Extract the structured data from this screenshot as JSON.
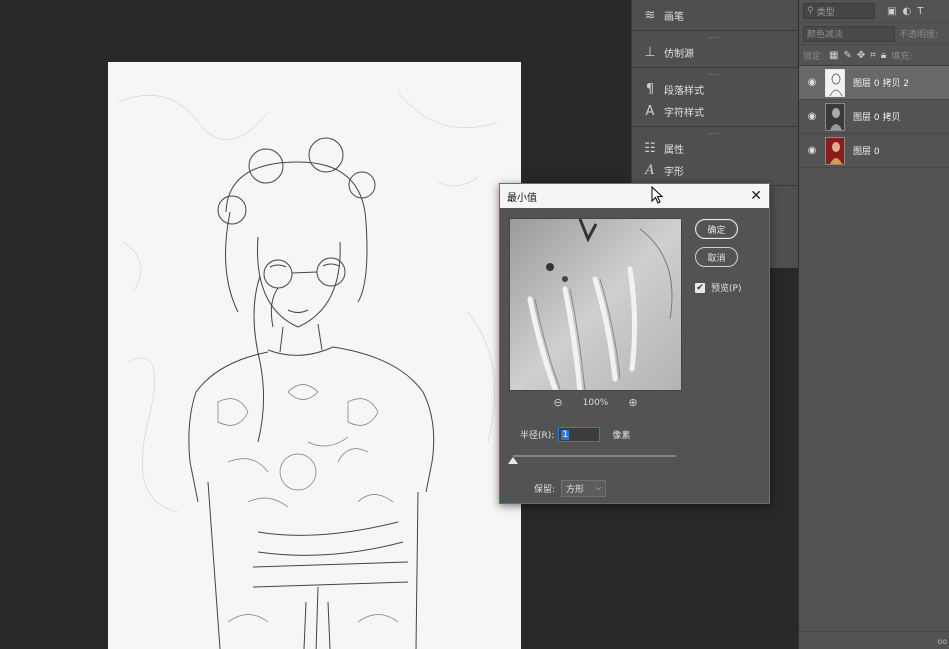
{
  "canvas": {
    "image": "pencil-sketch-portrait"
  },
  "mid_panel": {
    "groups": [
      {
        "items": [
          {
            "icon": "brush-settings-icon",
            "label": "画笔"
          }
        ]
      },
      {
        "items": [
          {
            "icon": "clone-source-icon",
            "label": "仿制源"
          }
        ]
      },
      {
        "items": [
          {
            "icon": "paragraph-style-icon",
            "label": "段落样式"
          },
          {
            "icon": "character-style-icon",
            "label": "字符样式"
          }
        ]
      },
      {
        "items": [
          {
            "icon": "properties-icon",
            "label": "属性"
          },
          {
            "icon": "glyphs-icon",
            "label": "字形"
          }
        ]
      }
    ]
  },
  "layers_panel": {
    "kind_placeholder": "类型",
    "blend_mode": "颜色减淡",
    "opacity_label": "不透明度:",
    "lock_label": "锁定:",
    "fill_label": "填充:",
    "layers": [
      {
        "name": "图层 0 拷贝 2",
        "visible": true,
        "selected": true
      },
      {
        "name": "图层 0 拷贝",
        "visible": true,
        "selected": false
      },
      {
        "name": "图层 0",
        "visible": true,
        "selected": false
      }
    ],
    "footer": "oo"
  },
  "dialog": {
    "title": "最小值",
    "ok_label": "确定",
    "cancel_label": "取消",
    "preview_label": "预览(P)",
    "preview_checked": true,
    "zoom_level": "100%",
    "radius_label": "半径(R):",
    "radius_value": "1",
    "radius_unit": "像素",
    "radius_slider_fraction": 0.0,
    "preserve_label": "保留:",
    "preserve_value": "方形"
  }
}
